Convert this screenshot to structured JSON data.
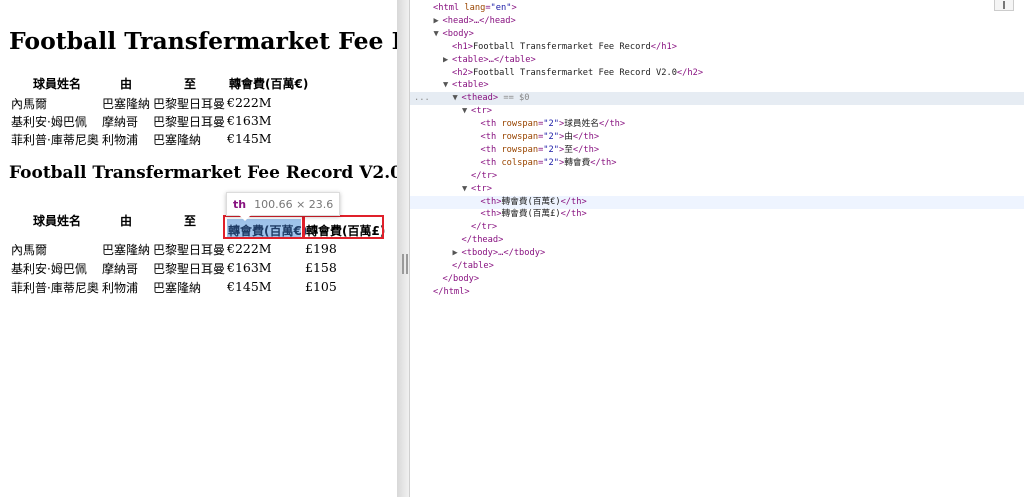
{
  "page": {
    "h1": "Football Transfermarket Fee Record",
    "h2": "Football Transfermarket Fee Record V2.0",
    "table1": {
      "headers": [
        "球員姓名",
        "由",
        "至",
        "轉會費(百萬€)"
      ],
      "rows": [
        [
          "內馬爾",
          "巴塞隆納",
          "巴黎聖日耳曼",
          "€222M"
        ],
        [
          "基利安·姆巴佩",
          "摩納哥",
          "巴黎聖日耳曼",
          "€163M"
        ],
        [
          "菲利普·庫蒂尼奧",
          "利物浦",
          "巴塞隆納",
          "€145M"
        ]
      ]
    },
    "table2": {
      "headers": [
        "球員姓名",
        "由",
        "至",
        "轉會費"
      ],
      "subheaders": [
        "轉會費(百萬€)",
        "轉會費(百萬£)"
      ],
      "rows": [
        [
          "內馬爾",
          "巴塞隆納",
          "巴黎聖日耳曼",
          "€222M",
          "£198"
        ],
        [
          "基利安·姆巴佩",
          "摩納哥",
          "巴黎聖日耳曼",
          "€163M",
          "£158"
        ],
        [
          "菲利普·庫蒂尼奧",
          "利物浦",
          "巴塞隆納",
          "€145M",
          "£105"
        ]
      ]
    },
    "tooltip": {
      "tag": "th",
      "dims": "100.66 × 23.6"
    }
  },
  "devtools": {
    "lines": [
      {
        "indent": 0,
        "tri": "",
        "html": "<html lang=\"en\">"
      },
      {
        "indent": 1,
        "tri": "▶",
        "html": "<head>…</head>"
      },
      {
        "indent": 1,
        "tri": "▼",
        "html": "<body>"
      },
      {
        "indent": 2,
        "tri": "",
        "html": "<h1>Football Transfermarket Fee Record</h1>"
      },
      {
        "indent": 2,
        "tri": "▶",
        "html": "<table>…</table>"
      },
      {
        "indent": 2,
        "tri": "",
        "html": "<h2>Football Transfermarket Fee Record V2.0</h2>"
      },
      {
        "indent": 2,
        "tri": "▼",
        "html": "<table>"
      },
      {
        "indent": 3,
        "tri": "▼",
        "html": "<thead>",
        "suffix": " == $0",
        "selected": true
      },
      {
        "indent": 4,
        "tri": "▼",
        "html": "<tr>"
      },
      {
        "indent": 5,
        "tri": "",
        "html": "<th rowspan=\"2\">球員姓名</th>"
      },
      {
        "indent": 5,
        "tri": "",
        "html": "<th rowspan=\"2\">由</th>"
      },
      {
        "indent": 5,
        "tri": "",
        "html": "<th rowspan=\"2\">至</th>"
      },
      {
        "indent": 5,
        "tri": "",
        "html": "<th colspan=\"2\">轉會費</th>"
      },
      {
        "indent": 4,
        "tri": "",
        "html": "</tr>"
      },
      {
        "indent": 4,
        "tri": "▼",
        "html": "<tr>"
      },
      {
        "indent": 5,
        "tri": "",
        "html": "<th>轉會費(百萬€)</th>",
        "hover": true
      },
      {
        "indent": 5,
        "tri": "",
        "html": "<th>轉會費(百萬£)</th>"
      },
      {
        "indent": 4,
        "tri": "",
        "html": "</tr>"
      },
      {
        "indent": 3,
        "tri": "",
        "html": "</thead>"
      },
      {
        "indent": 3,
        "tri": "▶",
        "html": "<tbody>…</tbody>"
      },
      {
        "indent": 2,
        "tri": "",
        "html": "</table>"
      },
      {
        "indent": 1,
        "tri": "",
        "html": "</body>"
      },
      {
        "indent": 0,
        "tri": "",
        "html": "</html>"
      }
    ],
    "ellipsis": "..."
  }
}
